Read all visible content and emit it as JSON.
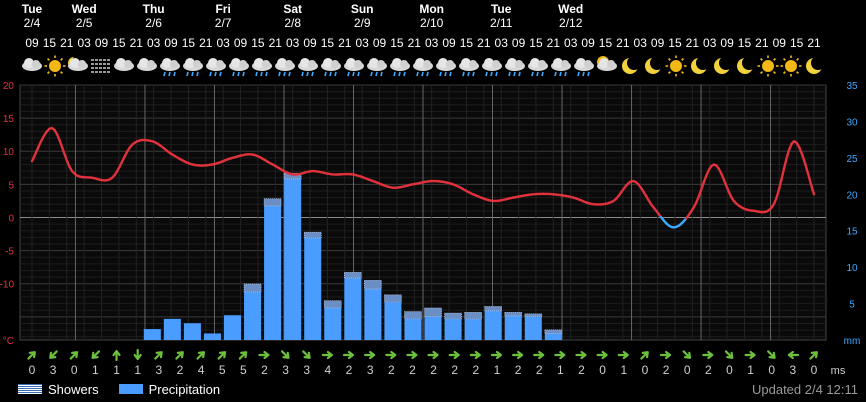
{
  "days": [
    {
      "name": "Tue",
      "date": "2/4"
    },
    {
      "name": "Wed",
      "date": "2/5"
    },
    {
      "name": "Thu",
      "date": "2/6"
    },
    {
      "name": "Fri",
      "date": "2/7"
    },
    {
      "name": "Sat",
      "date": "2/8"
    },
    {
      "name": "Sun",
      "date": "2/9"
    },
    {
      "name": "Mon",
      "date": "2/10"
    },
    {
      "name": "Tue",
      "date": "2/11"
    },
    {
      "name": "Wed",
      "date": "2/12"
    }
  ],
  "hours": [
    "09",
    "15",
    "21",
    "03",
    "09",
    "15",
    "21",
    "03",
    "09",
    "15",
    "21",
    "03",
    "09",
    "15",
    "21",
    "03",
    "09",
    "15",
    "21",
    "03",
    "09",
    "15",
    "21",
    "03",
    "09",
    "15",
    "21",
    "03",
    "09",
    "15",
    "21",
    "03",
    "09",
    "15",
    "21",
    "03",
    "09",
    "15",
    "21",
    "03",
    "09",
    "15",
    "21",
    "09",
    "15",
    "21"
  ],
  "icons": [
    "cloudy-icon",
    "sun-icon",
    "partly-cloudy-night-icon",
    "fog-icon",
    "cloudy-icon",
    "cloudy-icon",
    "rain-cloud-icon",
    "rain-cloud-icon",
    "rain-cloud-icon",
    "rain-cloud-icon",
    "rain-cloud-icon",
    "rain-cloud-icon",
    "rain-cloud-icon",
    "rain-cloud-icon",
    "rain-cloud-icon",
    "rain-cloud-icon",
    "rain-cloud-icon",
    "rain-cloud-icon",
    "rain-cloud-icon",
    "rain-cloud-icon",
    "rain-cloud-icon",
    "rain-cloud-icon",
    "rain-cloud-icon",
    "rain-cloud-icon",
    "rain-cloud-icon",
    "sun-behind-cloud-icon",
    "moon-icon",
    "moon-icon",
    "sun-icon",
    "moon-icon",
    "moon-icon",
    "moon-icon",
    "sun-icon",
    "sun-icon",
    "moon-icon"
  ],
  "chart_data": {
    "type": "line",
    "series": [
      {
        "type": "line",
        "axis": "left",
        "unit": "°C",
        "values": [
          8.5,
          13.5,
          7,
          6,
          6,
          11,
          11.5,
          9.5,
          8,
          8,
          9,
          9.5,
          8,
          6.5,
          7,
          6.5,
          6.5,
          5.5,
          4.5,
          5,
          5.5,
          5,
          3.5,
          2.5,
          3,
          3.5,
          3.5,
          3,
          2,
          2.5,
          5.5,
          1.5,
          -1.5,
          1.5,
          8,
          2.5,
          1,
          2,
          11.5,
          3.5
        ]
      },
      {
        "type": "bar",
        "axis": "right",
        "unit": "mm",
        "name": "Precipitation",
        "values": [
          0,
          0,
          0,
          0,
          0,
          0,
          1.5,
          2.9,
          2.3,
          0.9,
          3.4,
          6.6,
          18.4,
          22.1,
          14,
          4.4,
          8.5,
          7,
          5.2,
          2.9,
          3.2,
          2.9,
          2.9,
          4,
          3.3,
          3.2,
          0.9,
          0,
          0,
          0,
          0,
          0,
          0,
          0,
          0,
          0,
          0,
          0,
          0,
          0
        ]
      },
      {
        "type": "bar",
        "axis": "right",
        "unit": "mm",
        "name": "Showers",
        "values": [
          0,
          0,
          0,
          0,
          0,
          0,
          0,
          0,
          0,
          0,
          0,
          1.1,
          1,
          0.8,
          0.8,
          1,
          0.8,
          1.2,
          1,
          1,
          1.2,
          0.8,
          0.9,
          0.6,
          0.5,
          0.4,
          0.5,
          0,
          0,
          0,
          0,
          0,
          0,
          0,
          0,
          0,
          0,
          0,
          0,
          0
        ]
      }
    ],
    "y_left_ticks": [
      "20",
      "15",
      "10",
      "5",
      "0",
      "-5",
      "-10"
    ],
    "y_left_unit": "°C",
    "y_left_range": [
      -18.5,
      20
    ],
    "y_right_ticks": [
      "35",
      "30",
      "25",
      "20",
      "15",
      "10",
      "5"
    ],
    "y_right_unit": "mm",
    "y_right_range": [
      0,
      35
    ],
    "grid": true
  },
  "wind": {
    "unit": "ms",
    "values": [
      "0",
      "3",
      "0",
      "1",
      "1",
      "1",
      "3",
      "2",
      "4",
      "5",
      "5",
      "2",
      "3",
      "3",
      "4",
      "2",
      "3",
      "2",
      "2",
      "2",
      "2",
      "2",
      "1",
      "2",
      "2",
      "1",
      "2",
      "0",
      "1",
      "0",
      "2",
      "0",
      "2",
      "0",
      "1",
      "0",
      "3",
      "0"
    ],
    "directions": [
      "NE",
      "SW",
      "NE",
      "SW",
      "N",
      "S",
      "NE",
      "NE",
      "NE",
      "NE",
      "NE",
      "E",
      "SE",
      "SE",
      "E",
      "E",
      "E",
      "E",
      "E",
      "E",
      "E",
      "E",
      "E",
      "E",
      "E",
      "E",
      "E",
      "E",
      "E",
      "NE",
      "E",
      "SE",
      "E",
      "SE",
      "E",
      "SE",
      "W",
      "NE"
    ]
  },
  "legend": {
    "showers": "Showers",
    "precipitation": "Precipitation"
  },
  "updated": "Updated 2/4 12:11",
  "colors": {
    "temp_pos": "#e0323c",
    "temp_neg": "#3da8ff",
    "precip": "#4a9cff",
    "wind": "#6cc03c",
    "grid": "#3a3a3a",
    "day_line": "#666666"
  }
}
